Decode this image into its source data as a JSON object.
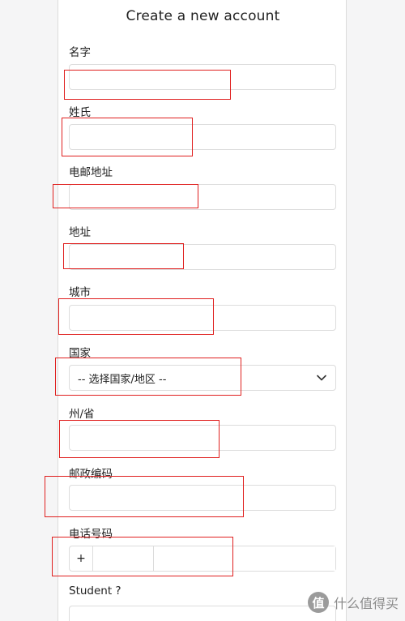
{
  "form": {
    "title": "Create a new account",
    "first_name_label": "名字",
    "last_name_label": "姓氏",
    "email_label": "电邮地址",
    "address_label": "地址",
    "city_label": "城市",
    "country_label": "国家",
    "country_selected": "-- 选择国家/地区 --",
    "state_label": "州/省",
    "postal_label": "邮政编码",
    "phone_label": "电话号码",
    "phone_prefix": "+",
    "student_label": "Student ?"
  },
  "watermark": {
    "logo_text": "值",
    "text": "什么值得买"
  },
  "colors": {
    "annotation_red": "#e0201f",
    "border": "#dcdcdc"
  }
}
